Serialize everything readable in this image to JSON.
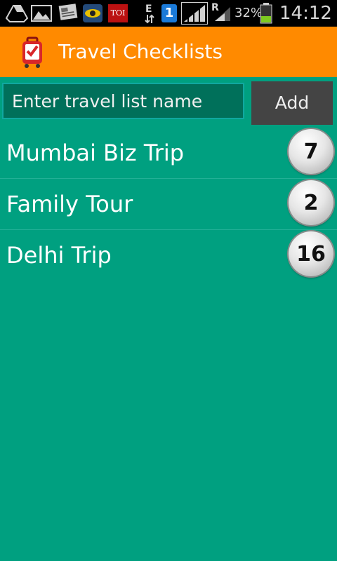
{
  "status_bar": {
    "network_type": "E",
    "sim_slot": "1",
    "roaming": "R",
    "battery_percent": "32%",
    "time": "14:12",
    "icons": [
      "drive-icon",
      "gallery-icon",
      "news-icon",
      "gov-icon",
      "toi-icon",
      "data-transfer-icon",
      "sim-icon",
      "signal-icon",
      "signal-roaming-icon",
      "battery-icon"
    ],
    "toi_label": "TOI"
  },
  "action_bar": {
    "title": "Travel Checklists",
    "color": "#ff8a00"
  },
  "form": {
    "placeholder": "Enter travel list name",
    "value": "",
    "add_label": "Add"
  },
  "lists": [
    {
      "name": "Mumbai Biz Trip",
      "count": "7"
    },
    {
      "name": "Family Tour",
      "count": "2"
    },
    {
      "name": "Delhi Trip",
      "count": "16"
    }
  ],
  "colors": {
    "background": "#00a080",
    "input_bg": "#00705a",
    "button_bg": "#444444"
  }
}
